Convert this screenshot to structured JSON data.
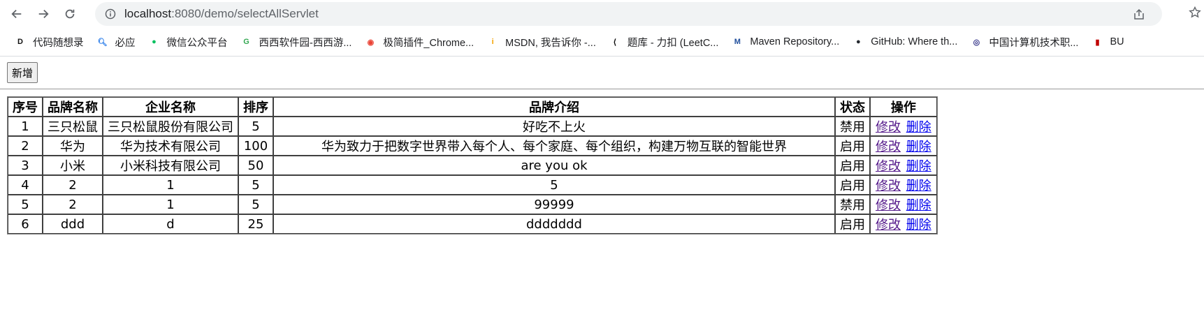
{
  "browser": {
    "url_host": "localhost",
    "url_path": ":8080/demo/selectAllServlet",
    "bookmarks": [
      {
        "label": "代码随想录",
        "icon": "dm-logo-icon",
        "color": "#111111"
      },
      {
        "label": "必应",
        "icon": "search-icon",
        "color": "#1a73e8"
      },
      {
        "label": "微信公众平台",
        "icon": "wechat-icon",
        "color": "#07c160"
      },
      {
        "label": "西西软件园-西西游...",
        "icon": "xixi-icon",
        "color": "#34a853"
      },
      {
        "label": "极简插件_Chrome...",
        "icon": "chrome-icon",
        "color": "#ea4335"
      },
      {
        "label": "MSDN, 我告诉你 -...",
        "icon": "msdn-icon",
        "color": "#f4a300"
      },
      {
        "label": "题库 - 力扣 (LeetC...",
        "icon": "leetcode-icon",
        "color": "#000000"
      },
      {
        "label": "Maven Repository...",
        "icon": "maven-icon",
        "color": "#1f4e9c"
      },
      {
        "label": "GitHub: Where th...",
        "icon": "github-icon",
        "color": "#24292f"
      },
      {
        "label": "中国计算机技术职...",
        "icon": "ccf-icon",
        "color": "#3a3a8c"
      },
      {
        "label": "BU",
        "icon": "bu-icon",
        "color": "#c00000"
      }
    ]
  },
  "page": {
    "add_button": "新增",
    "table": {
      "headers": [
        "序号",
        "品牌名称",
        "企业名称",
        "排序",
        "品牌介绍",
        "状态",
        "操作"
      ],
      "rows": [
        {
          "id": "1",
          "brand": "三只松鼠",
          "company": "三只松鼠股份有限公司",
          "order": "5",
          "desc": "好吃不上火",
          "status": "禁用"
        },
        {
          "id": "2",
          "brand": "华为",
          "company": "华为技术有限公司",
          "order": "100",
          "desc": "华为致力于把数字世界带入每个人、每个家庭、每个组织，构建万物互联的智能世界",
          "status": "启用"
        },
        {
          "id": "3",
          "brand": "小米",
          "company": "小米科技有限公司",
          "order": "50",
          "desc": "are you ok",
          "status": "启用"
        },
        {
          "id": "4",
          "brand": "2",
          "company": "1",
          "order": "5",
          "desc": "5",
          "status": "启用"
        },
        {
          "id": "5",
          "brand": "2",
          "company": "1",
          "order": "5",
          "desc": "99999",
          "status": "禁用"
        },
        {
          "id": "6",
          "brand": "ddd",
          "company": "d",
          "order": "25",
          "desc": "ddddddd",
          "status": "启用"
        }
      ],
      "edit_label": "修改",
      "delete_label": "删除",
      "link_color": "#0000ee",
      "visited_color": "#551a8b"
    }
  }
}
